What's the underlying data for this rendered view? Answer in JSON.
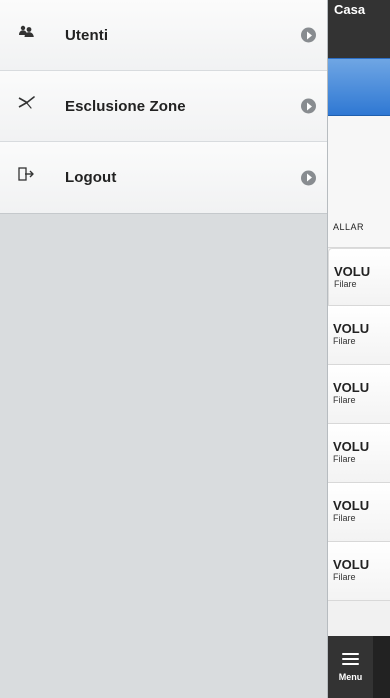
{
  "menu": {
    "items": [
      {
        "label": "Utenti",
        "icon": "users-icon"
      },
      {
        "label": "Esclusione Zone",
        "icon": "zone-exclusion-icon"
      },
      {
        "label": "Logout",
        "icon": "logout-icon"
      }
    ]
  },
  "app": {
    "header_title": "Casa",
    "status_label": "ALLAR",
    "zones": [
      {
        "title": "VOLU",
        "subtitle": "Filare"
      },
      {
        "title": "VOLU",
        "subtitle": "Filare"
      },
      {
        "title": "VOLU",
        "subtitle": "Filare"
      },
      {
        "title": "VOLU",
        "subtitle": "Filare"
      },
      {
        "title": "VOLU",
        "subtitle": "Filare"
      },
      {
        "title": "VOLU",
        "subtitle": "Filare"
      }
    ],
    "footer": {
      "menu_label": "Menu"
    }
  },
  "colors": {
    "blue_bar": "#3f86d9",
    "header": "#333333",
    "menu_background": "#d9dcde"
  }
}
